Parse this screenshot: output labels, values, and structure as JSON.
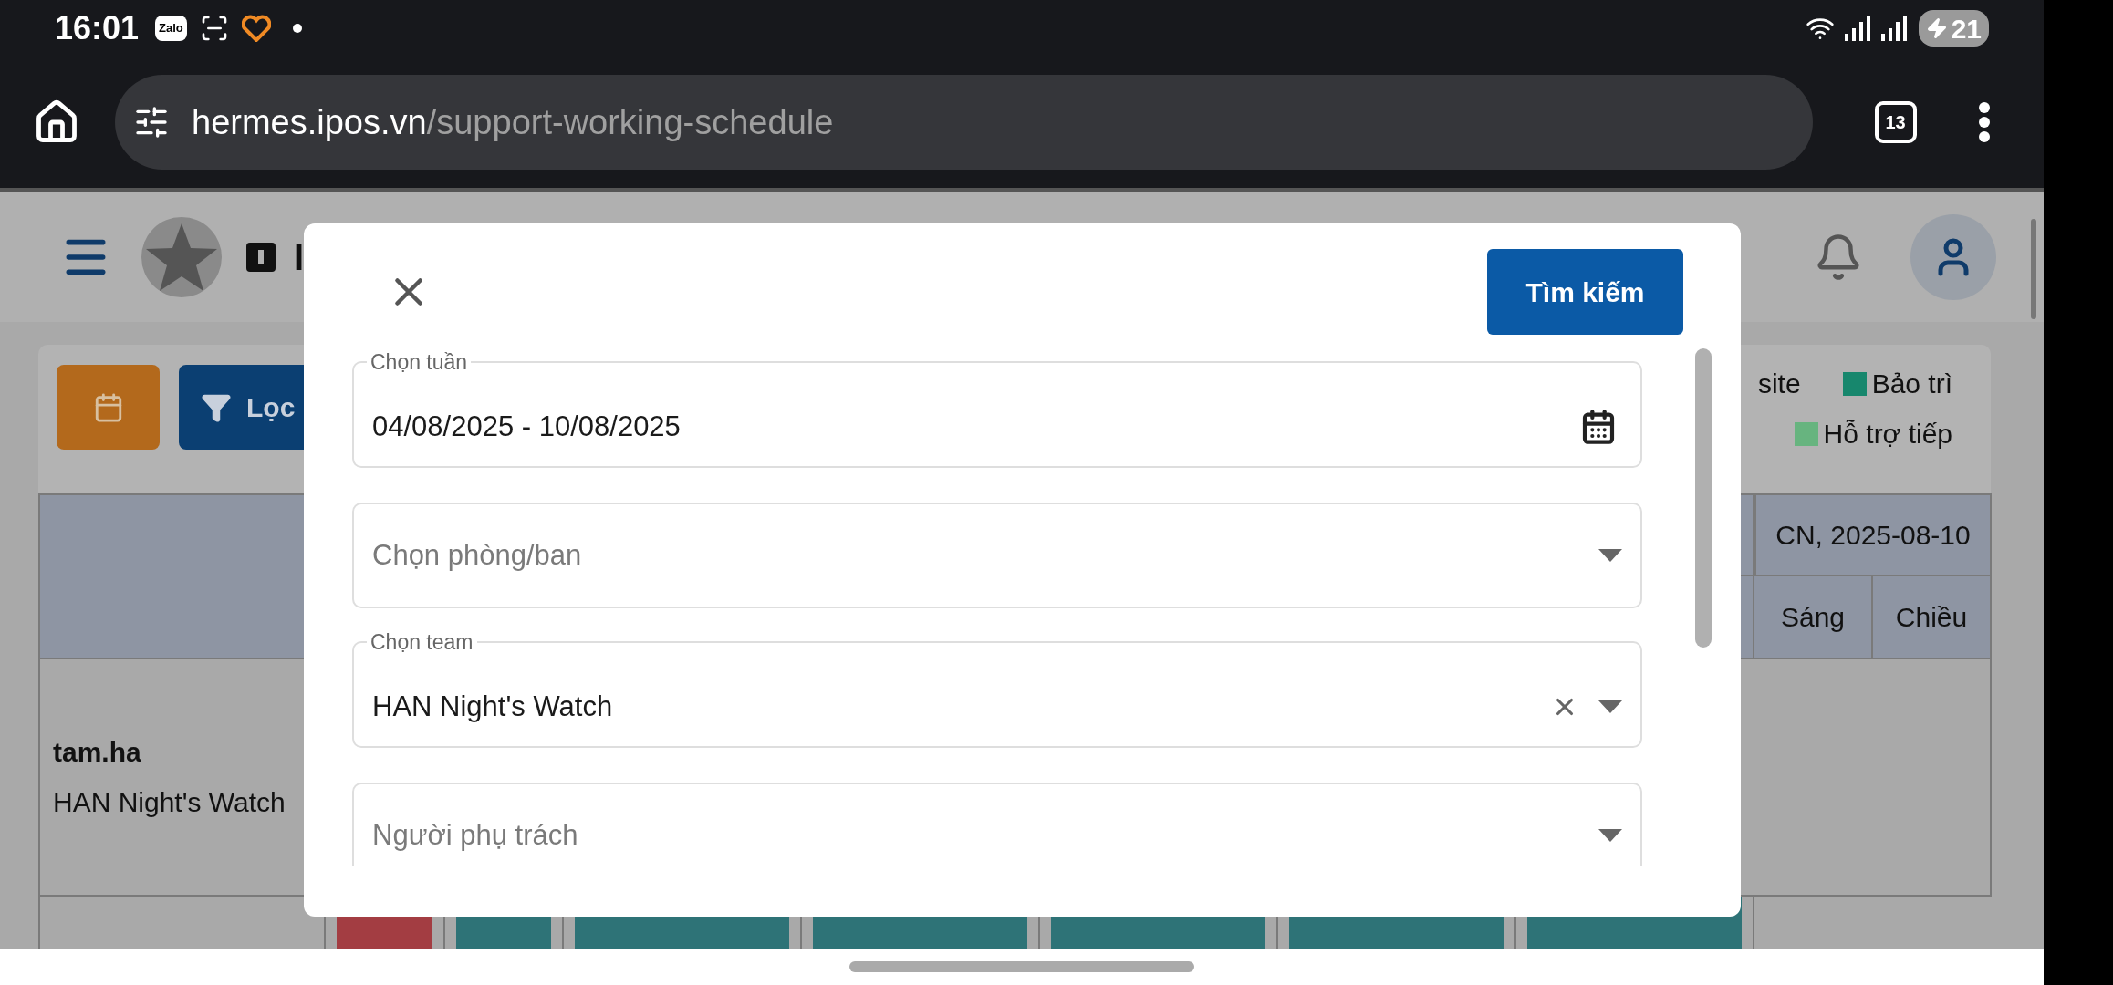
{
  "status_bar": {
    "time": "16:01",
    "notification_app": "Zalo",
    "battery": "21"
  },
  "browser": {
    "url_host": "hermes.ipos.vn",
    "url_path": "/support-working-schedule",
    "tab_count": "13"
  },
  "header": {
    "title_fragment": "I"
  },
  "toolbar": {
    "filter_button": "Lọc",
    "legend": [
      {
        "label": "site"
      },
      {
        "label": "Bảo trì",
        "color": "#17876d"
      },
      {
        "label": "Hỗ trợ tiếp",
        "color": "#67b47f"
      }
    ]
  },
  "table": {
    "day_header": "CN, 2025-08-10",
    "shift_headers": [
      "Sáng",
      "Chiều"
    ],
    "rows": [
      {
        "user": "tam.ha",
        "team": "HAN Night's Watch"
      }
    ],
    "shift_bars": [
      {
        "color": "#a33d42"
      },
      {
        "color": "#2e7377"
      },
      {
        "color": "#2e7377"
      },
      {
        "color": "#2e7377"
      },
      {
        "color": "#2e7377"
      },
      {
        "color": "#2e7377"
      },
      {
        "color": "#2e7377"
      }
    ]
  },
  "modal": {
    "search_button": "Tìm kiếm",
    "fields": [
      {
        "kind": "date",
        "label": "Chọn tuần",
        "value": "04/08/2025 - 10/08/2025"
      },
      {
        "kind": "select",
        "placeholder": "Chọn phòng/ban"
      },
      {
        "kind": "select",
        "label": "Chọn team",
        "value": "HAN Night's Watch",
        "clearable": true
      },
      {
        "kind": "select",
        "placeholder": "Người phụ trách"
      }
    ]
  }
}
